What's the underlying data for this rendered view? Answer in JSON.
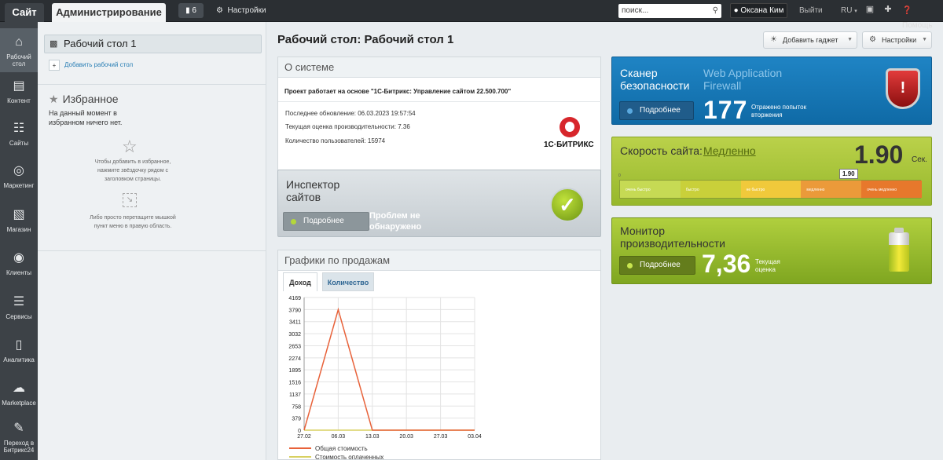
{
  "topbar": {
    "site_tab": "Сайт",
    "admin_tab": "Администрирование",
    "notifications_count": "6",
    "settings": "Настройки",
    "search_placeholder": "поиск...",
    "user_name": "Оксана Ким",
    "logout": "Выйти",
    "lang": "RU",
    "help": "Помощь"
  },
  "left_menu": [
    {
      "label": "Рабочий стол",
      "icon": "home-icon"
    },
    {
      "label": "Контент",
      "icon": "document-icon"
    },
    {
      "label": "Сайты",
      "icon": "calendar-24-icon"
    },
    {
      "label": "Маркетинг",
      "icon": "target-icon"
    },
    {
      "label": "Магазин",
      "icon": "basket-icon"
    },
    {
      "label": "Клиенты",
      "icon": "clients-24-icon"
    },
    {
      "label": "Сервисы",
      "icon": "layers-icon"
    },
    {
      "label": "Аналитика",
      "icon": "bar-chart-icon"
    },
    {
      "label": "Marketplace",
      "icon": "cloud-download-icon"
    },
    {
      "label": "Переход в Битрикс24",
      "icon": "bitrix24-icon"
    }
  ],
  "side_panel": {
    "desktop_item": "Рабочий стол 1",
    "add_desktop": "Добавить рабочий стол",
    "favorites_title": "Избранное",
    "favorites_empty": "На данный момент в избранном ничего нет.",
    "hint_star": "Чтобы добавить в избранное, нажмите звёздочку рядом с заголовком страницы.",
    "hint_drag": "Либо просто перетащите мышкой пункт меню в правую область."
  },
  "main": {
    "page_title": "Рабочий стол: Рабочий стол 1",
    "add_gadget": "Добавить гаджет",
    "settings": "Настройки"
  },
  "about": {
    "title": "О системе",
    "project_line": "Проект работает на основе \"1С-Битрикс: Управление сайтом 22.500.700\"",
    "last_update": "Последнее обновление: 06.03.2023 19:57:54",
    "perf_score": "Текущая оценка производительности: 7.36",
    "user_count": "Количество пользователей: 15974",
    "logo_text": "1С·БИТРИКС"
  },
  "inspector": {
    "title": "Инспектор сайтов",
    "button": "Подробнее",
    "status": "Проблем не обнаружено"
  },
  "sales": {
    "title": "Графики по продажам",
    "tabs": [
      "Доход",
      "Количество"
    ],
    "legend": [
      "Общая стоимость",
      "Стоимость оплаченных"
    ]
  },
  "chart_data": {
    "type": "line",
    "x": [
      "27.02",
      "06.03",
      "13.03",
      "20.03",
      "27.03",
      "03.04"
    ],
    "y_ticks": [
      0,
      379,
      758,
      1137,
      1516,
      1895,
      2274,
      2653,
      3032,
      3411,
      3790,
      4169
    ],
    "ylim": [
      0,
      4169
    ],
    "series": [
      {
        "name": "Общая стоимость",
        "color": "#e8623a",
        "values": [
          0,
          3790,
          0,
          0,
          0,
          0
        ]
      },
      {
        "name": "Стоимость оплаченных",
        "color": "#d8d060",
        "values": [
          0,
          0,
          0,
          0,
          0,
          0
        ]
      }
    ],
    "grid": true,
    "legend_position": "bottom-left"
  },
  "scanner": {
    "title": "Сканер безопасности",
    "subtitle": "Web Application Firewall",
    "button": "Подробнее",
    "count": "177",
    "caption": "Отражено попыток вторжения"
  },
  "speed": {
    "label": "Скорость сайта:",
    "value": "Медленно",
    "number": "1.90",
    "unit": "Сек.",
    "marker": "1.90",
    "tick0": "0",
    "segments": [
      "очень быстро",
      "быстро",
      "не быстро",
      "медленно",
      "очень медленно"
    ],
    "colors": [
      "#c6da54",
      "#c9d03a",
      "#f0c93b",
      "#eb9a3a",
      "#e7782c"
    ],
    "marker_fraction": 0.76
  },
  "monitor": {
    "title": "Монитор производительности",
    "button": "Подробнее",
    "value": "7,36",
    "caption": "Текущая оценка"
  }
}
